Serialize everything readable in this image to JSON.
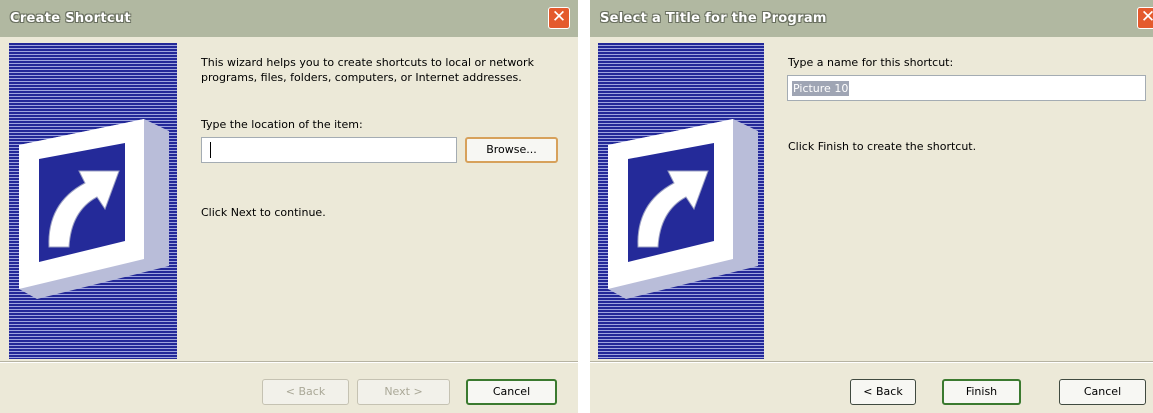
{
  "dialog1": {
    "title": "Create Shortcut",
    "close_glyph": "✕",
    "banner_icon": "shortcut-arrow-icon",
    "intro_text": "This wizard helps you to create shortcuts to local or network programs, files, folders, computers, or Internet addresses.",
    "location_label": "Type the location of the item:",
    "location_value": "",
    "browse_label": "Browse...",
    "continue_text": "Click Next to continue.",
    "buttons": {
      "back": "< Back",
      "next": "Next >",
      "cancel": "Cancel"
    }
  },
  "dialog2": {
    "title": "Select a Title for the Program",
    "close_glyph": "✕",
    "banner_icon": "shortcut-arrow-icon",
    "name_label": "Type a name for this shortcut:",
    "name_value": "Picture 10",
    "finish_text": "Click Finish to create the shortcut.",
    "buttons": {
      "back": "< Back",
      "finish": "Finish",
      "cancel": "Cancel"
    }
  },
  "colors": {
    "dialog_bg": "#ece9d8",
    "titlebar": "#b1b8a1",
    "banner_blue": "#262ba0",
    "close_red": "#e45a2d",
    "default_button_border": "#3b7a2f",
    "focus_button_border": "#d7a15b"
  }
}
